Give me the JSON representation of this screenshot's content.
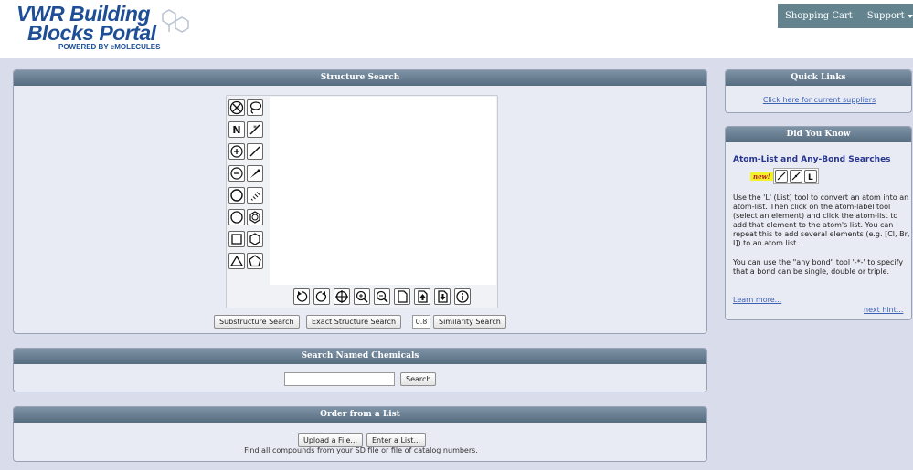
{
  "logo": {
    "line1": "VWR Building",
    "line2": "Blocks Portal",
    "powered": "POWERED BY eMOLECULES"
  },
  "topnav": {
    "cart": "Shopping Cart",
    "support": "Support"
  },
  "structure_search": {
    "title": "Structure Search",
    "substructure_button": "Substructure Search",
    "exact_button": "Exact Structure Search",
    "similarity_value": "0.8",
    "similarity_button": "Similarity Search"
  },
  "named_chemicals": {
    "title": "Search Named Chemicals",
    "input_value": "",
    "search_button": "Search"
  },
  "order_list": {
    "title": "Order from a List",
    "upload_button": "Upload a File...",
    "enter_button": "Enter a List...",
    "description": "Find all compounds from your SD file or file of catalog numbers."
  },
  "quick_links": {
    "title": "Quick Links",
    "link": "Click here for current suppliers"
  },
  "did_you_know": {
    "title": "Did You Know",
    "heading": "Atom-List and Any-Bond Searches",
    "new_badge": "new!",
    "paragraph1": "Use the 'L' (List) tool to convert an atom into an atom-list. Then click on the atom-label tool (select an element) and click the atom-list to add that element to the atom's list. You can repeat this to add several elements (e.g. [Cl, Br, I]) to an atom list.",
    "paragraph2": "You can use the \"any bond\" tool '-*-' to specify that a bond can be single, double or triple.",
    "learn_more": "Learn more...",
    "next_hint": "next hint..."
  },
  "editor_tools": {
    "atom_label": "N"
  }
}
